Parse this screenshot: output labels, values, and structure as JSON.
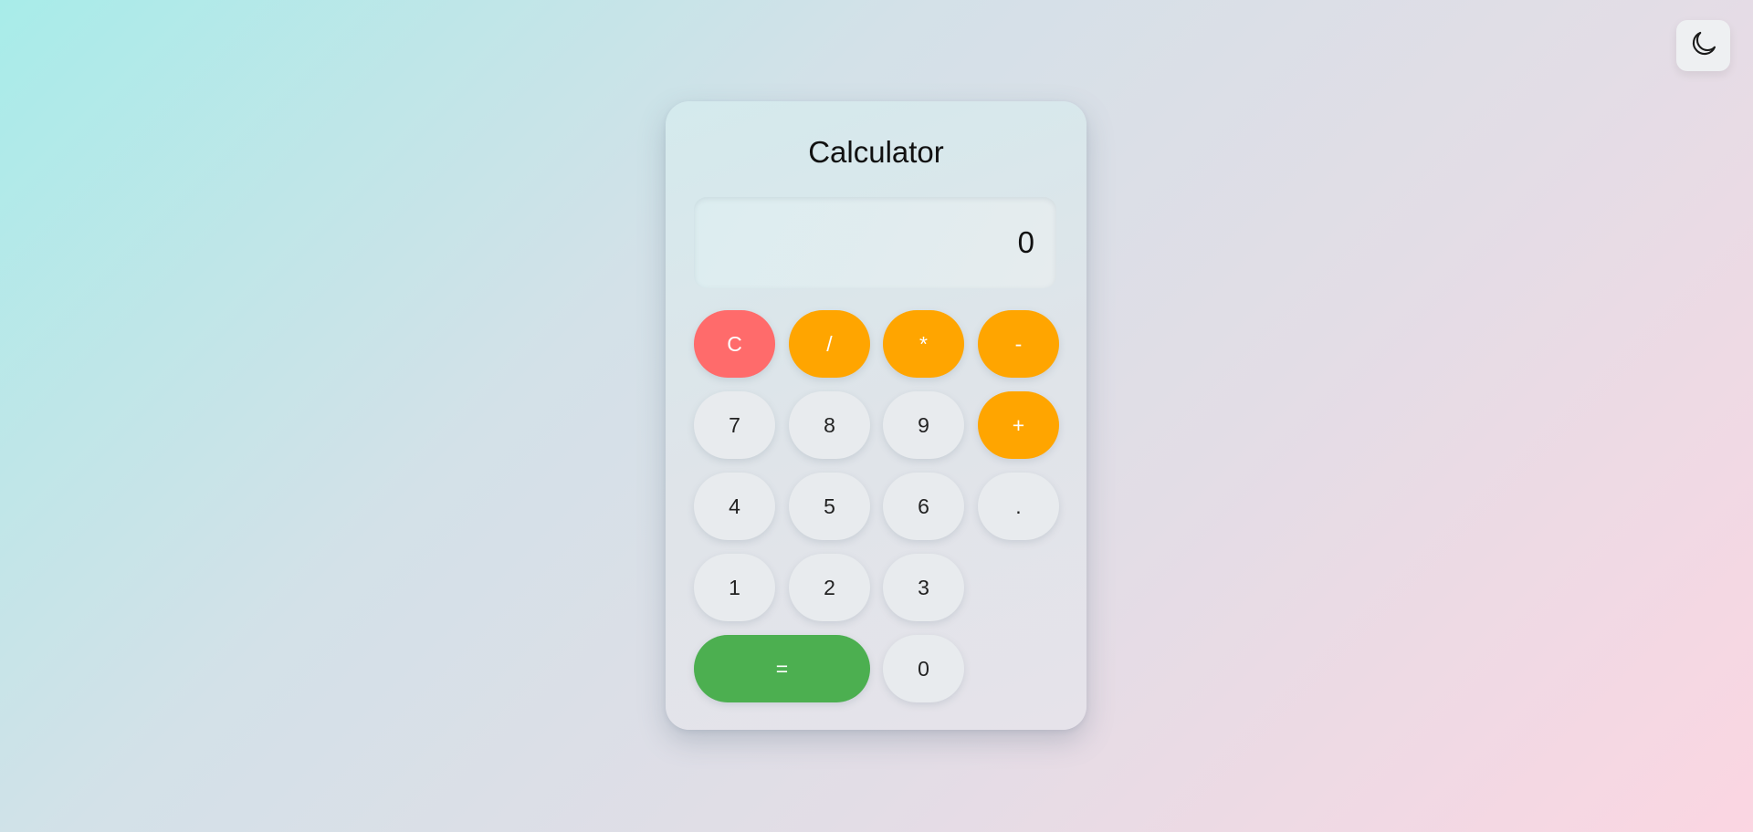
{
  "page": {
    "title": "Calculator",
    "theme_toggle_icon": "moon-icon"
  },
  "display": {
    "value": "0"
  },
  "keys": {
    "clear": "C",
    "divide": "/",
    "multiply": "*",
    "subtract": "-",
    "add": "+",
    "seven": "7",
    "eight": "8",
    "nine": "9",
    "four": "4",
    "five": "5",
    "six": "6",
    "decimal": ".",
    "one": "1",
    "two": "2",
    "three": "3",
    "equals": "=",
    "zero": "0"
  },
  "colors": {
    "operator": "#ffa500",
    "clear": "#ff6b6b",
    "equals": "#4caf50",
    "digit": "#e8ebee"
  }
}
